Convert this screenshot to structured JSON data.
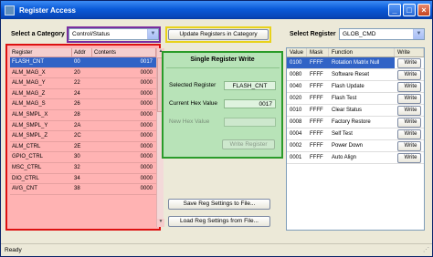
{
  "window": {
    "title": "Register Access",
    "minimize": "_",
    "maximize": "□",
    "close": "×"
  },
  "category": {
    "label": "Select a Category",
    "value": "Control/Status"
  },
  "update_button": "Update Registers in Category",
  "register_select": {
    "label": "Select Register",
    "value": "GLOB_CMD"
  },
  "left_table": {
    "columns": [
      "Register",
      "Addr",
      "Contents"
    ],
    "rows": [
      {
        "reg": "FLASH_CNT",
        "addr": "00",
        "contents": "0017"
      },
      {
        "reg": "ALM_MAG_X",
        "addr": "20",
        "contents": "0000"
      },
      {
        "reg": "ALM_MAG_Y",
        "addr": "22",
        "contents": "0000"
      },
      {
        "reg": "ALM_MAG_Z",
        "addr": "24",
        "contents": "0000"
      },
      {
        "reg": "ALM_MAG_S",
        "addr": "26",
        "contents": "0000"
      },
      {
        "reg": "ALM_SMPL_X",
        "addr": "28",
        "contents": "0000"
      },
      {
        "reg": "ALM_SMPL_Y",
        "addr": "2A",
        "contents": "0000"
      },
      {
        "reg": "ALM_SMPL_Z",
        "addr": "2C",
        "contents": "0000"
      },
      {
        "reg": "ALM_CTRL",
        "addr": "2E",
        "contents": "0000"
      },
      {
        "reg": "GPIO_CTRL",
        "addr": "30",
        "contents": "0000"
      },
      {
        "reg": "MSC_CTRL",
        "addr": "32",
        "contents": "0000"
      },
      {
        "reg": "DIO_CTRL",
        "addr": "34",
        "contents": "0000"
      },
      {
        "reg": "AVG_CNT",
        "addr": "38",
        "contents": "0000"
      }
    ]
  },
  "single_write": {
    "title": "Single Register Write",
    "selected_label": "Selected Register",
    "selected_value": "FLASH_CNT",
    "current_label": "Current Hex Value",
    "current_value": "0017",
    "new_label": "New Hex Value",
    "new_value": "",
    "write_button": "Write Register"
  },
  "save_button": "Save Reg Settings to File...",
  "load_button": "Load Reg Settings from File...",
  "right_table": {
    "columns": [
      "Value",
      "Mask",
      "Function",
      "Write"
    ],
    "rows": [
      {
        "value": "0100",
        "mask": "FFFF",
        "function": "Rotation Matrix Null",
        "write": "Write"
      },
      {
        "value": "0080",
        "mask": "FFFF",
        "function": "Software Reset",
        "write": "Write"
      },
      {
        "value": "0040",
        "mask": "FFFF",
        "function": "Flash Update",
        "write": "Write"
      },
      {
        "value": "0020",
        "mask": "FFFF",
        "function": "Flash Test",
        "write": "Write"
      },
      {
        "value": "0010",
        "mask": "FFFF",
        "function": "Clear Status",
        "write": "Write"
      },
      {
        "value": "0008",
        "mask": "FFFF",
        "function": "Factory Restore",
        "write": "Write"
      },
      {
        "value": "0004",
        "mask": "FFFF",
        "function": "Self Test",
        "write": "Write"
      },
      {
        "value": "0002",
        "mask": "FFFF",
        "function": "Power Down",
        "write": "Write"
      },
      {
        "value": "0001",
        "mask": "FFFF",
        "function": "Auto Align",
        "write": "Write"
      }
    ]
  },
  "status": "Ready",
  "colors": {
    "titlebar": "#0a5ad8",
    "selection": "#3163c6",
    "left_highlight": "#ffb3b3",
    "left_border": "#dd1111",
    "green_panel": "#b8e3b8",
    "green_border": "#2a9b2a",
    "category_border": "#7a2ea0",
    "update_border": "#e8d21a"
  }
}
